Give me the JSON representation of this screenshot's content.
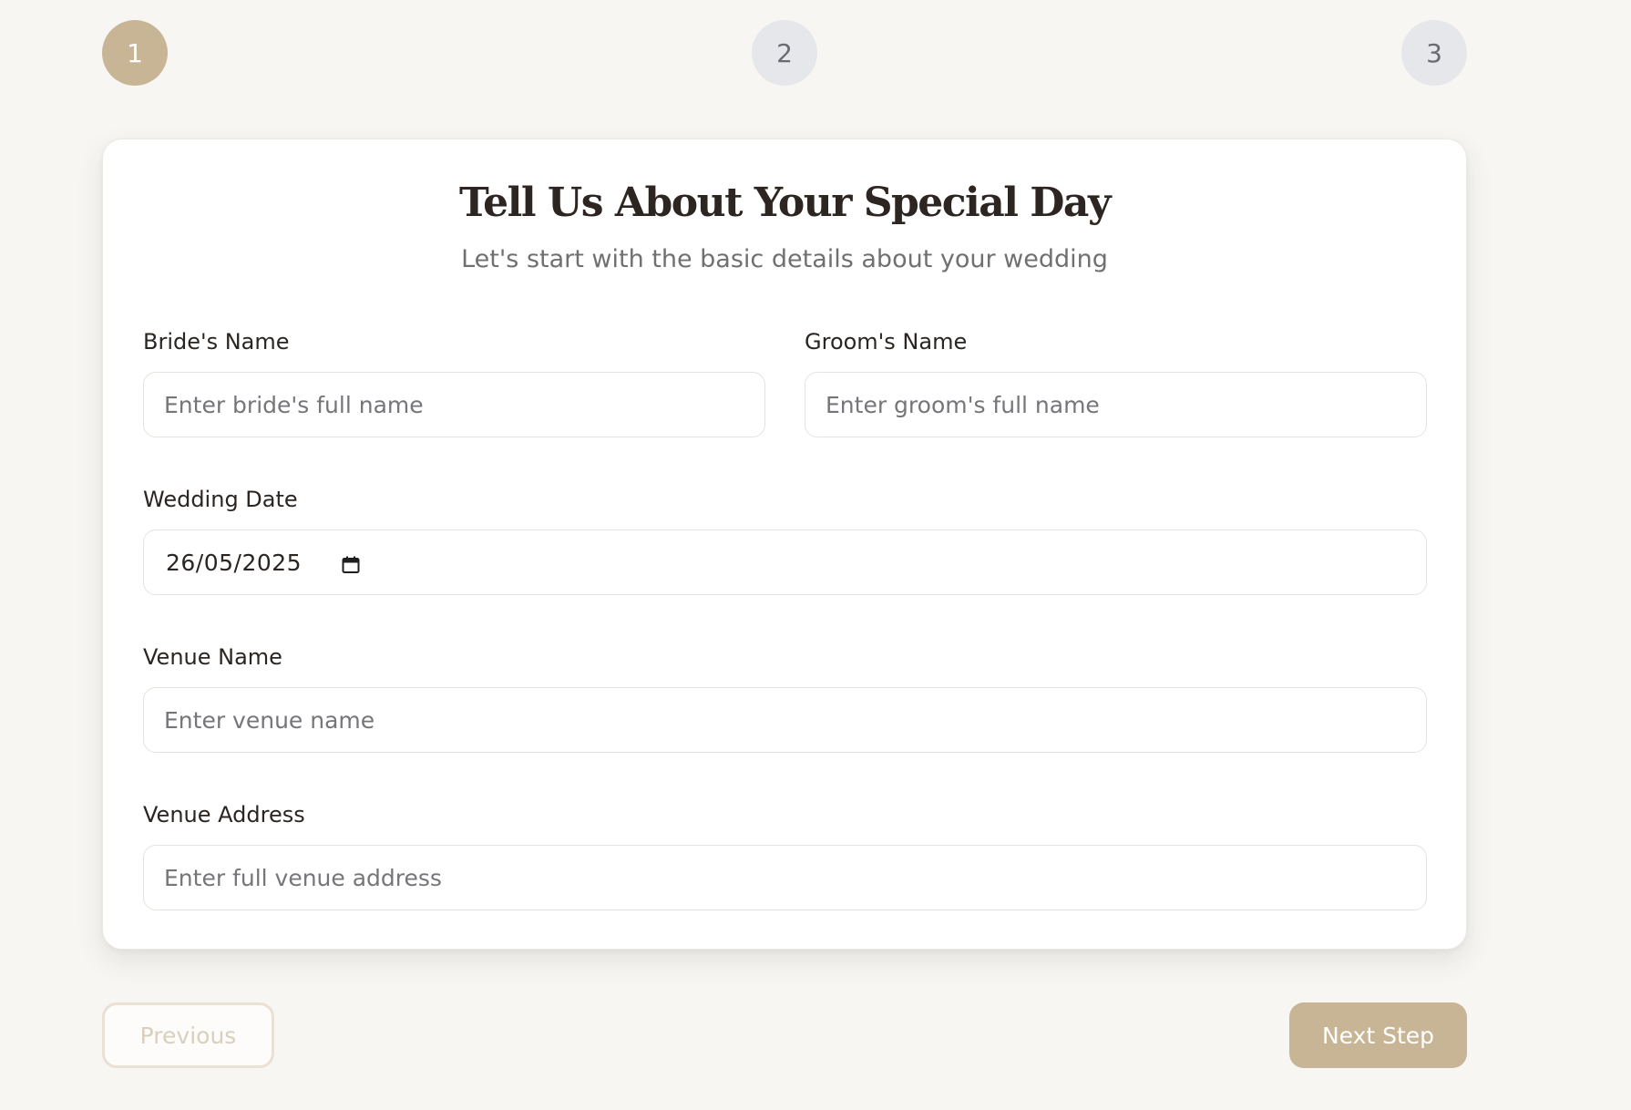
{
  "stepper": {
    "steps": [
      {
        "label": "1",
        "state": "active"
      },
      {
        "label": "2",
        "state": "inactive"
      },
      {
        "label": "3",
        "state": "inactive"
      }
    ],
    "current_step": 1
  },
  "form": {
    "title": "Tell Us About Your Special Day",
    "subtitle": "Let's start with the basic details about your wedding",
    "bride": {
      "label": "Bride's Name",
      "placeholder": "Enter bride's full name",
      "value": ""
    },
    "groom": {
      "label": "Groom's Name",
      "placeholder": "Enter groom's full name",
      "value": ""
    },
    "date": {
      "label": "Wedding Date",
      "value": "26/05/2025",
      "icon": "calendar-icon"
    },
    "venue": {
      "label": "Venue Name",
      "placeholder": "Enter venue name",
      "value": ""
    },
    "address": {
      "label": "Venue Address",
      "placeholder": "Enter full venue address",
      "value": ""
    }
  },
  "buttons": {
    "previous": "Previous",
    "next": "Next Step"
  },
  "colors": {
    "accent": "#c8b595",
    "background": "#f7f6f3",
    "inactive_step": "#e6e7ea",
    "card": "#ffffff"
  }
}
